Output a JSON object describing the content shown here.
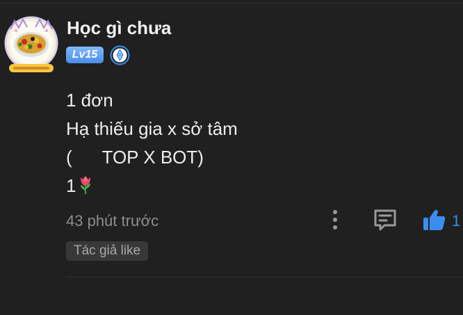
{
  "comment": {
    "username": "Học gì chưa",
    "level_badge": "Lv15",
    "content_lines": [
      "1 đơn",
      "Hạ thiếu gia x sở tâm",
      "(      TOP X BOT)",
      "1"
    ],
    "timestamp": "43 phút trước",
    "like_count": "1",
    "author_like_tag": "Tác giả like"
  },
  "icons": {
    "verified": "verified-badge-icon",
    "more": "more-vertical-icon",
    "comment": "comment-icon",
    "like": "thumbs-up-icon",
    "tulip": "tulip-emoji"
  },
  "colors": {
    "background": "#202020",
    "accent_blue": "#3b8ef0",
    "level_badge": "#5b9cf0",
    "muted_text": "#8e8e8e",
    "tag_background": "#383838"
  }
}
